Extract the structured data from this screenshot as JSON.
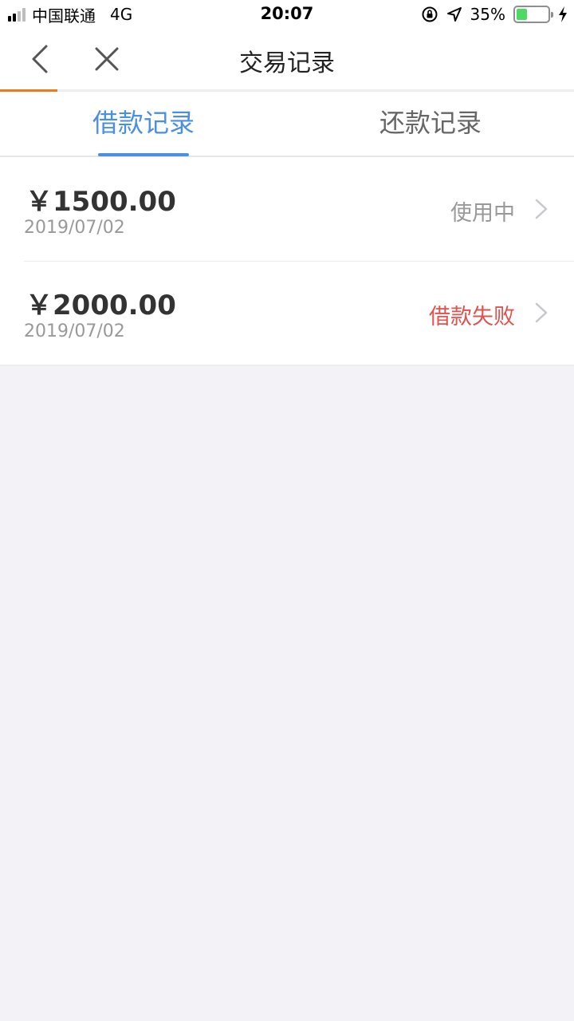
{
  "status_bar": {
    "carrier": "中国联通",
    "network": "4G",
    "time": "20:07",
    "battery_percent_text": "35%",
    "battery_level": 0.35,
    "battery_color": "#4cd964",
    "icons": [
      "signal-icon",
      "rotation-lock-icon",
      "location-icon",
      "battery-icon",
      "charging-icon"
    ]
  },
  "nav": {
    "title": "交易记录",
    "back_icon": "chevron-left-icon",
    "close_icon": "close-icon",
    "load_progress": 0.1,
    "progress_color": "#f07a1a"
  },
  "tabs": [
    {
      "label": "借款记录",
      "active": true
    },
    {
      "label": "还款记录",
      "active": false
    }
  ],
  "accent_color": "#4a8fe0",
  "records": [
    {
      "amount": "￥1500.00",
      "date": "2019/07/02",
      "status": "使用中",
      "status_color": "#999999"
    },
    {
      "amount": "￥2000.00",
      "date": "2019/07/02",
      "status": "借款失败",
      "status_color": "#e0524d"
    }
  ]
}
